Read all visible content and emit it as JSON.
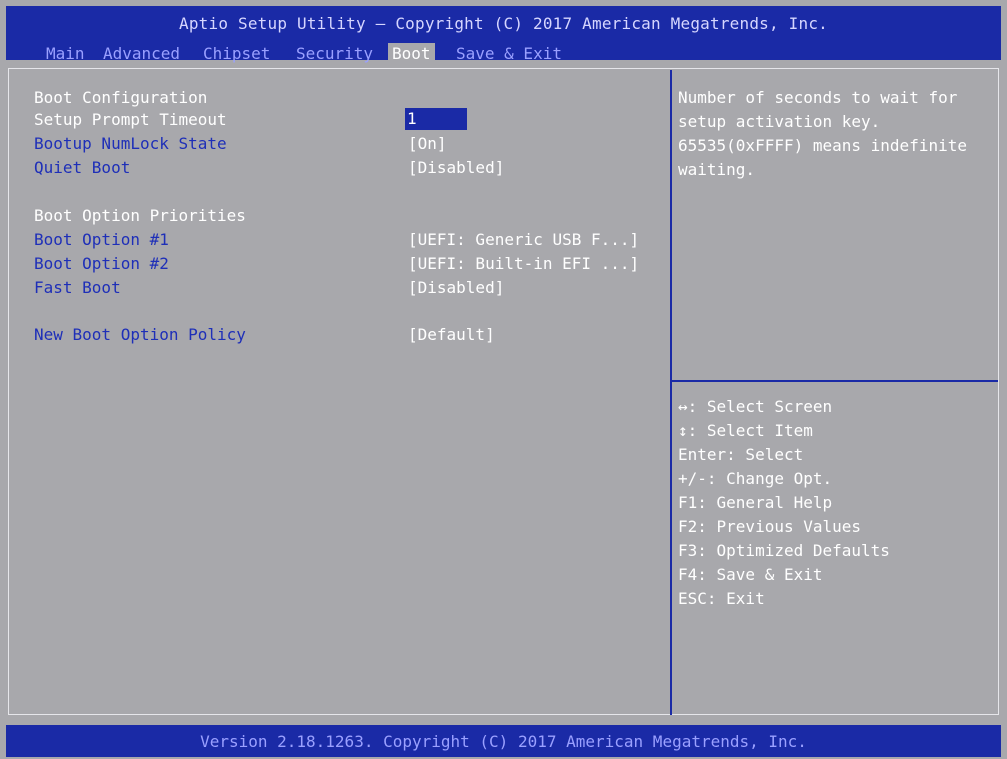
{
  "header": {
    "title": "Aptio Setup Utility – Copyright (C) 2017 American Megatrends, Inc.",
    "tabs": [
      "Main",
      "Advanced",
      "Chipset",
      "Security",
      "Boot",
      "Save & Exit"
    ],
    "active_tab": "Boot"
  },
  "settings": {
    "section1_heading": "Boot Configuration",
    "items": [
      {
        "label": "Setup Prompt Timeout",
        "value": "1"
      },
      {
        "label": "Bootup NumLock State",
        "value": "[On]"
      },
      {
        "label": "Quiet Boot",
        "value": "[Disabled]"
      }
    ],
    "section2_heading": "Boot Option Priorities",
    "items2": [
      {
        "label": "Boot Option #1",
        "value": "[UEFI: Generic USB F...]"
      },
      {
        "label": "Boot Option #2",
        "value": "[UEFI: Built-in EFI ...]"
      },
      {
        "label": "Fast Boot",
        "value": "[Disabled]"
      }
    ],
    "items3": [
      {
        "label": "New Boot Option Policy",
        "value": "[Default]"
      }
    ]
  },
  "help": {
    "description_lines": [
      "Number of seconds to wait for",
      "setup activation key.",
      "65535(0xFFFF) means indefinite",
      "waiting."
    ],
    "keys": [
      "↔: Select Screen",
      "↕: Select Item",
      "Enter: Select",
      "+/-: Change Opt.",
      "F1: General Help",
      "F2: Previous Values",
      "F3: Optimized Defaults",
      "F4: Save & Exit",
      "ESC: Exit"
    ]
  },
  "footer": {
    "text": "Version 2.18.1263. Copyright (C) 2017 American Megatrends, Inc."
  },
  "colors": {
    "panel_bg": "#a8a8ac",
    "header_blue": "#1a2aa6",
    "label_blue": "#1e2fb8",
    "text_white": "#ffffff"
  }
}
